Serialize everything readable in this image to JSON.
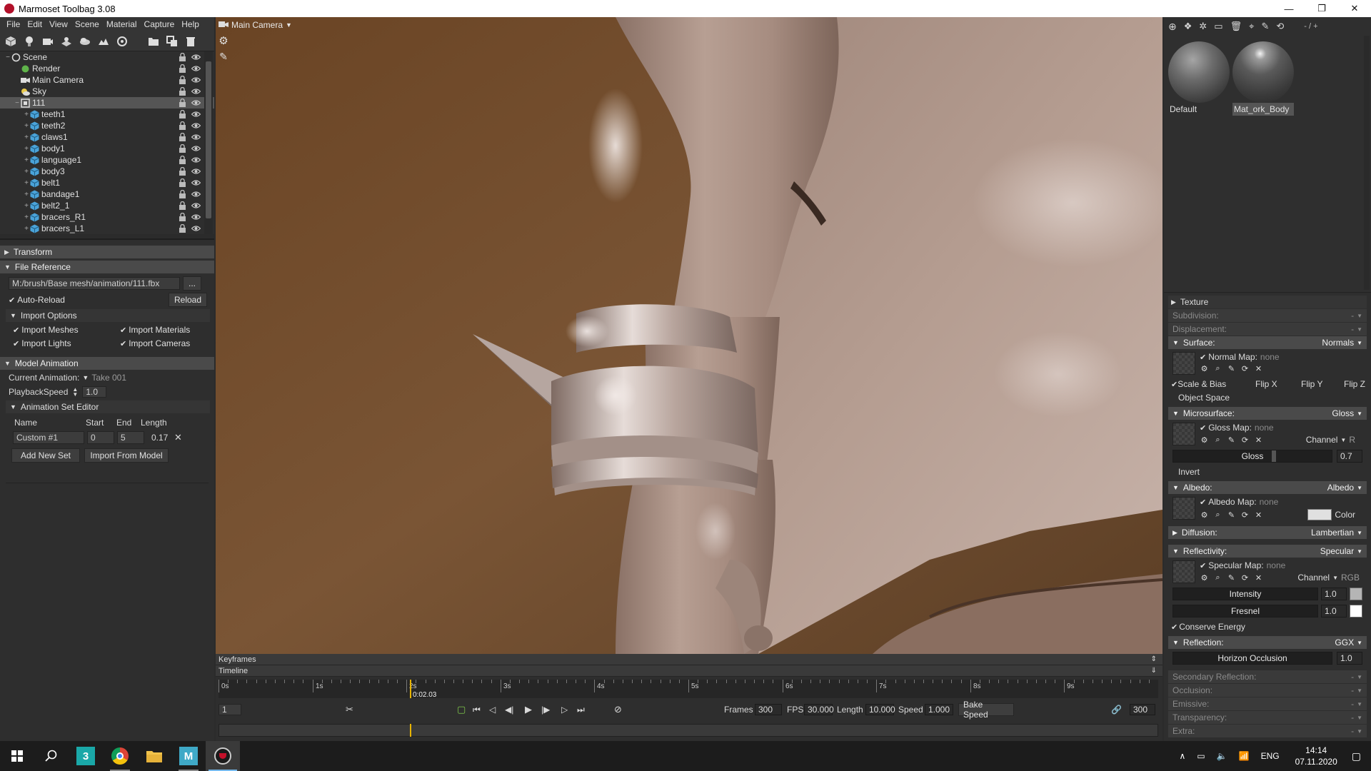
{
  "window": {
    "title": "Marmoset Toolbag 3.08",
    "minimize": "—",
    "restore": "❐",
    "close": "✕"
  },
  "menubar": {
    "items": [
      "File",
      "Edit",
      "View",
      "Scene",
      "Material",
      "Capture",
      "Help"
    ]
  },
  "left_toolbar": {
    "icons": [
      "mesh-icon",
      "light-icon",
      "camera-icon",
      "shadow-catcher-icon",
      "fog-icon",
      "terrain-icon",
      "turntable-icon",
      "folder-icon",
      "duplicate-icon",
      "delete-icon"
    ]
  },
  "scene_tree": {
    "items": [
      {
        "label": "Scene",
        "depth": 0,
        "icon": "scene-icon",
        "expander": "−"
      },
      {
        "label": "Render",
        "depth": 1,
        "icon": "render-icon",
        "expander": ""
      },
      {
        "label": "Main Camera",
        "depth": 1,
        "icon": "camera-icon",
        "expander": ""
      },
      {
        "label": "Sky",
        "depth": 1,
        "icon": "sky-icon",
        "expander": ""
      },
      {
        "label": "111",
        "depth": 1,
        "icon": "group-icon",
        "expander": "−",
        "selected": true
      },
      {
        "label": "teeth1",
        "depth": 2,
        "icon": "mesh-icon",
        "expander": "+"
      },
      {
        "label": "teeth2",
        "depth": 2,
        "icon": "mesh-icon",
        "expander": "+"
      },
      {
        "label": "claws1",
        "depth": 2,
        "icon": "mesh-icon",
        "expander": "+"
      },
      {
        "label": "body1",
        "depth": 2,
        "icon": "mesh-icon",
        "expander": "+"
      },
      {
        "label": "language1",
        "depth": 2,
        "icon": "mesh-icon",
        "expander": "+"
      },
      {
        "label": "body3",
        "depth": 2,
        "icon": "mesh-icon",
        "expander": "+"
      },
      {
        "label": "belt1",
        "depth": 2,
        "icon": "mesh-icon",
        "expander": "+"
      },
      {
        "label": "bandage1",
        "depth": 2,
        "icon": "mesh-icon",
        "expander": "+"
      },
      {
        "label": "belt2_1",
        "depth": 2,
        "icon": "mesh-icon",
        "expander": "+"
      },
      {
        "label": "bracers_R1",
        "depth": 2,
        "icon": "mesh-icon",
        "expander": "+"
      },
      {
        "label": "bracers_L1",
        "depth": 2,
        "icon": "mesh-icon",
        "expander": "+"
      }
    ]
  },
  "left_props": {
    "transform": "Transform",
    "file_reference": "File Reference",
    "file_path": "M:/brush/Base mesh/animation/111.fbx",
    "browse": "...",
    "auto_reload": "Auto-Reload",
    "reload": "Reload",
    "import_options": "Import Options",
    "import_meshes": "Import Meshes",
    "import_materials": "Import Materials",
    "import_lights": "Import Lights",
    "import_cameras": "Import Cameras",
    "model_animation": "Model Animation",
    "current_animation_label": "Current Animation:",
    "current_animation_value": "Take 001",
    "playback_speed_label": "PlaybackSpeed",
    "playback_speed_value": "1.0",
    "animation_set_editor": "Animation Set Editor",
    "col_name": "Name",
    "col_start": "Start",
    "col_end": "End",
    "col_length": "Length",
    "set_name": "Custom #1",
    "set_start": "0",
    "set_end": "5",
    "set_length": "0.17",
    "add_new_set": "Add New Set",
    "import_from_model": "Import From Model"
  },
  "viewport": {
    "camera": "Main Camera"
  },
  "timeline": {
    "keyframes": "Keyframes",
    "timeline": "Timeline",
    "ruler_labels": [
      "0s",
      "1s",
      "2s",
      "3s",
      "4s",
      "5s",
      "6s",
      "7s",
      "8s",
      "9s"
    ],
    "playhead_time": "0:02.03",
    "playhead_fraction": 0.2033,
    "current_frame": "1",
    "frames_label": "Frames",
    "frames": "300",
    "fps_label": "FPS",
    "fps": "30.000",
    "length_label": "Length",
    "length": "10.000",
    "speed_label": "Speed",
    "speed": "1.000",
    "bake_speed": "Bake Speed",
    "end_frame": "300"
  },
  "materials": {
    "toolbar_icons": [
      "add-material-icon",
      "duplicate-material-icon",
      "merge-icon",
      "folder-icon",
      "delete-icon",
      "pick-icon",
      "eyedropper-icon",
      "reset-icon"
    ],
    "page_indicator": "- / +",
    "items": [
      {
        "name": "Default",
        "active": false
      },
      {
        "name": "Mat_ork_Body",
        "active": true
      }
    ]
  },
  "material_props": {
    "texture": "Texture",
    "subdivision": "Subdivision:",
    "displacement": "Displacement:",
    "surface": "Surface:",
    "surface_mode": "Normals",
    "normal_map": "Normal Map:",
    "none": "none",
    "scale_bias": "Scale & Bias",
    "flip_x": "Flip X",
    "flip_y": "Flip Y",
    "flip_z": "Flip Z",
    "object_space": "Object Space",
    "microsurface": "Microsurface:",
    "microsurface_mode": "Gloss",
    "gloss_map": "Gloss Map:",
    "channel": "Channel",
    "channel_r": "R",
    "gloss": "Gloss",
    "gloss_value": "0.7",
    "invert": "Invert",
    "albedo": "Albedo:",
    "albedo_mode": "Albedo",
    "albedo_map": "Albedo Map:",
    "color": "Color",
    "diffusion": "Diffusion:",
    "diffusion_mode": "Lambertian",
    "reflectivity": "Reflectivity:",
    "reflectivity_mode": "Specular",
    "specular_map": "Specular Map:",
    "channel_rgb": "RGB",
    "intensity": "Intensity",
    "intensity_value": "1.0",
    "fresnel": "Fresnel",
    "fresnel_value": "1.0",
    "conserve_energy": "Conserve Energy",
    "reflection": "Reflection:",
    "reflection_mode": "GGX",
    "horizon_occlusion": "Horizon Occlusion",
    "horizon_value": "1.0",
    "secondary_reflection": "Secondary Reflection:",
    "occlusion": "Occlusion:",
    "emissive": "Emissive:",
    "transparency": "Transparency:",
    "extra": "Extra:",
    "dash": "-"
  },
  "taskbar": {
    "apps": [
      "windows-start-icon",
      "search-icon",
      "3dsmax-icon",
      "chrome-icon",
      "file-explorer-icon",
      "marvelous-icon",
      "marmoset-icon"
    ],
    "language": "ENG",
    "time": "14:14",
    "date": "07.11.2020"
  },
  "colors": {
    "accent": "#e8b400",
    "panel": "#2e2e2e",
    "header": "#4a4a4a",
    "viewport_bg": "#6b4a2e"
  }
}
